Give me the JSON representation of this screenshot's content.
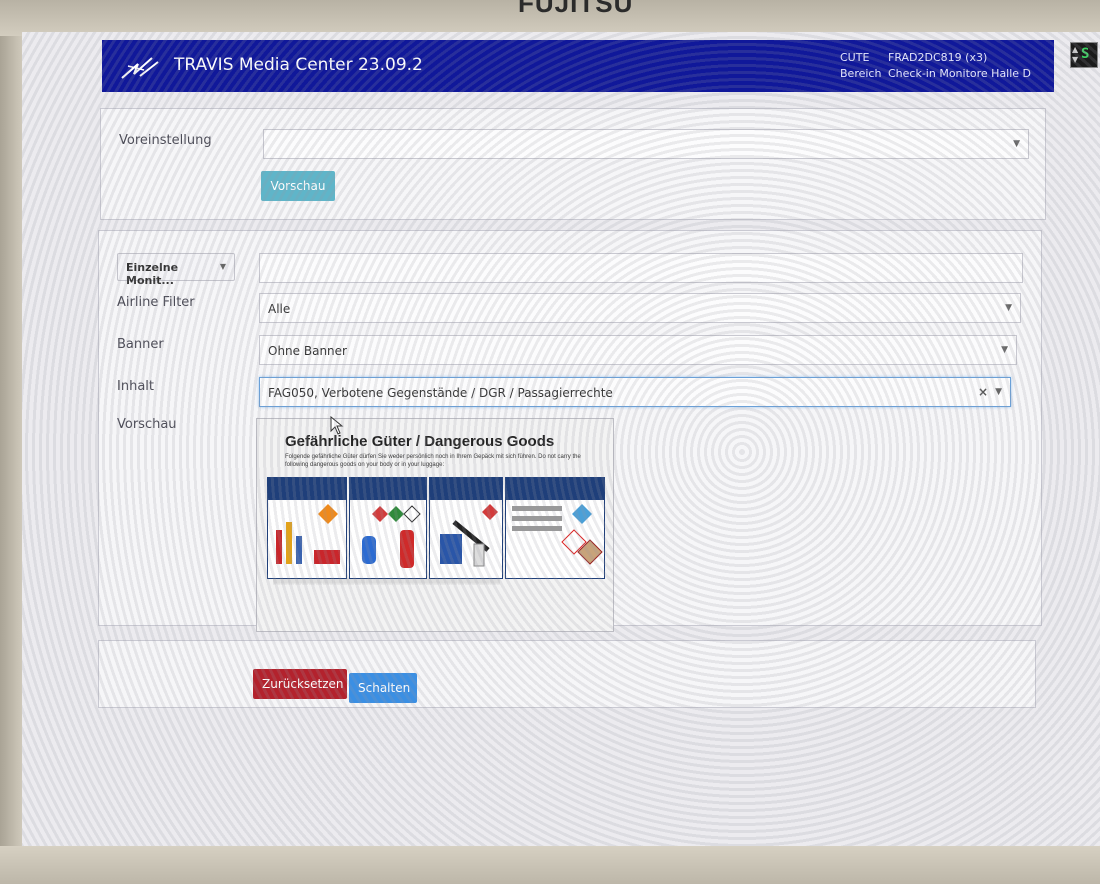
{
  "monitor": {
    "brand": "FUJITSU"
  },
  "header": {
    "app_title": "TRAVIS Media Center 23.09.2",
    "meta": {
      "cute_label": "CUTE",
      "cute_value": "FRAD2DC819 (x3)",
      "area_label": "Bereich",
      "area_value": "Check-in Monitore Halle D"
    }
  },
  "side_widget": {
    "digit": "S"
  },
  "preset": {
    "label": "Voreinstellung",
    "value": "",
    "preview_button": "Vorschau"
  },
  "config": {
    "mode_select": "Einzelne Monit...",
    "monitor_field": "",
    "airline_filter": {
      "label": "Airline Filter",
      "value": "Alle"
    },
    "banner": {
      "label": "Banner",
      "value": "Ohne Banner"
    },
    "content": {
      "label": "Inhalt",
      "value": "FAG050, Verbotene Gegenstände / DGR / Passagierrechte",
      "clear_icon": "×"
    },
    "preview": {
      "label": "Vorschau",
      "poster_title": "Gefährliche Güter / Dangerous Goods",
      "poster_subtitle": "Folgende gefährliche Güter dürfen Sie weder persönlich noch in Ihrem Gepäck mit sich führen. Do not carry the following dangerous goods on your body or in your luggage:"
    }
  },
  "actions": {
    "reset_button": "Zurücksetzen",
    "switch_button": "Schalten"
  },
  "colors": {
    "header_bg": "#10189a",
    "preview_button": "#5fb5c9",
    "reset_button": "#b3222d",
    "switch_button": "#3b8fe3"
  }
}
